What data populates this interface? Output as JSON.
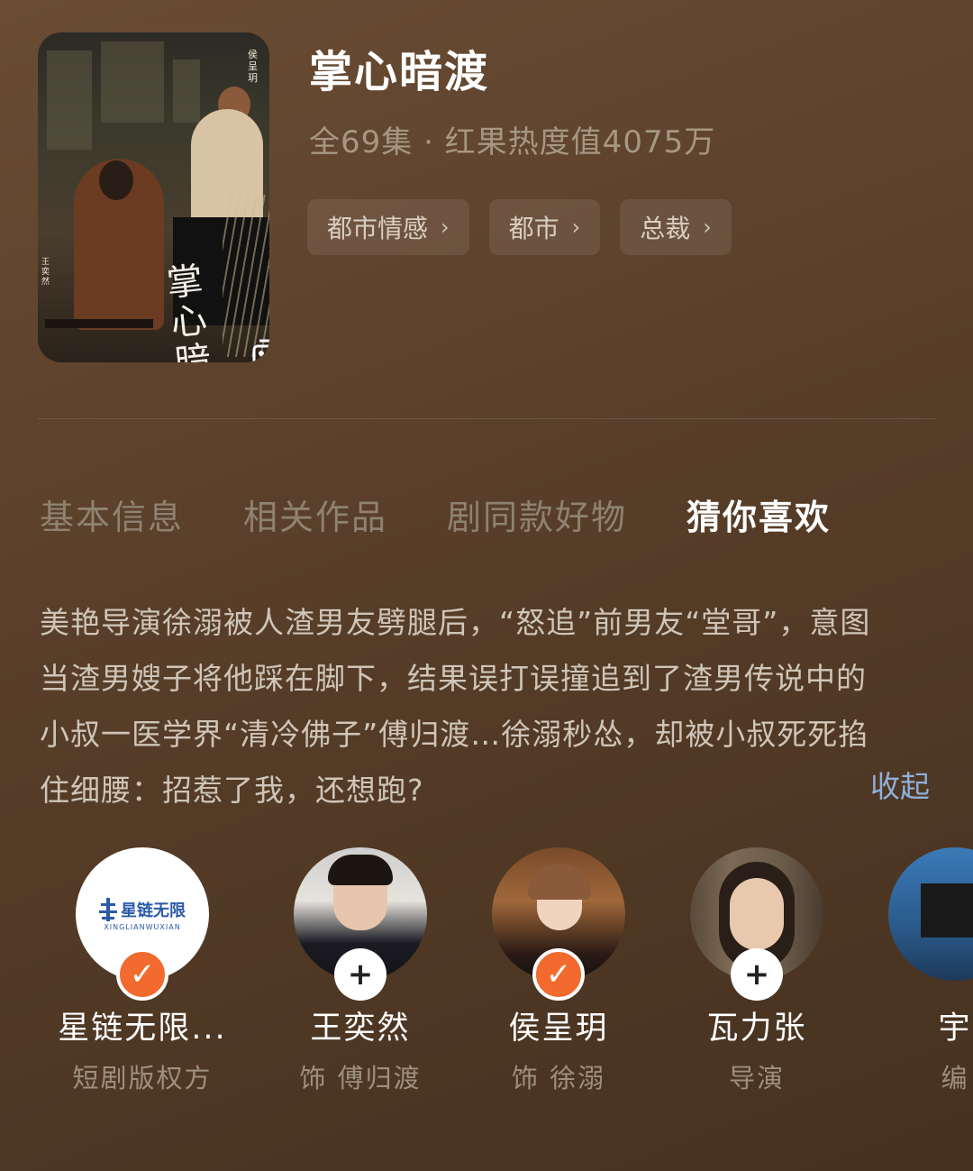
{
  "drama": {
    "title": "掌心暗渡",
    "meta": "全69集 · 红果热度值4075万",
    "poster_calligraphy": "掌心暗渡",
    "poster_names_right": "侯呈玥",
    "poster_names_left": "王奕然"
  },
  "tags": [
    {
      "label": "都市情感"
    },
    {
      "label": "都市"
    },
    {
      "label": "总裁"
    }
  ],
  "tabs": [
    {
      "label": "基本信息",
      "active": false
    },
    {
      "label": "相关作品",
      "active": false
    },
    {
      "label": "剧同款好物",
      "active": false
    },
    {
      "label": "猜你喜欢",
      "active": true
    }
  ],
  "synopsis": {
    "lines": [
      "美艳导演徐溺被人渣男友劈腿后，“怒追”前男友“堂哥”，意图",
      "当渣男嫂子将他踩在脚下，结果误打误撞追到了渣男传说中的",
      "小叔一医学界“清冷佛子”傅归渡…徐溺秒怂，却被小叔死死掐",
      "住细腰：招惹了我，还想跑?"
    ],
    "collapse_label": "收起"
  },
  "people": [
    {
      "name": "星链无限...",
      "role": "短剧版权方",
      "followed": true,
      "logo_cn": "星链无限",
      "logo_en": "XINGLIANWUXIAN"
    },
    {
      "name": "王奕然",
      "role": "饰 傅归渡",
      "followed": false
    },
    {
      "name": "侯呈玥",
      "role": "饰 徐溺",
      "followed": true
    },
    {
      "name": "瓦力张",
      "role": "导演",
      "followed": false
    },
    {
      "name": "宇",
      "role": "编",
      "followed": false
    }
  ],
  "colors": {
    "accent_orange": "#f26a2e",
    "link_blue": "#8fb0d9",
    "background": "#5c412b"
  },
  "icons": {
    "poster_overlay": "gallery-icon",
    "tag_arrow": "chevron-right-icon",
    "follow_done": "check-icon",
    "follow_add": "plus-icon"
  }
}
